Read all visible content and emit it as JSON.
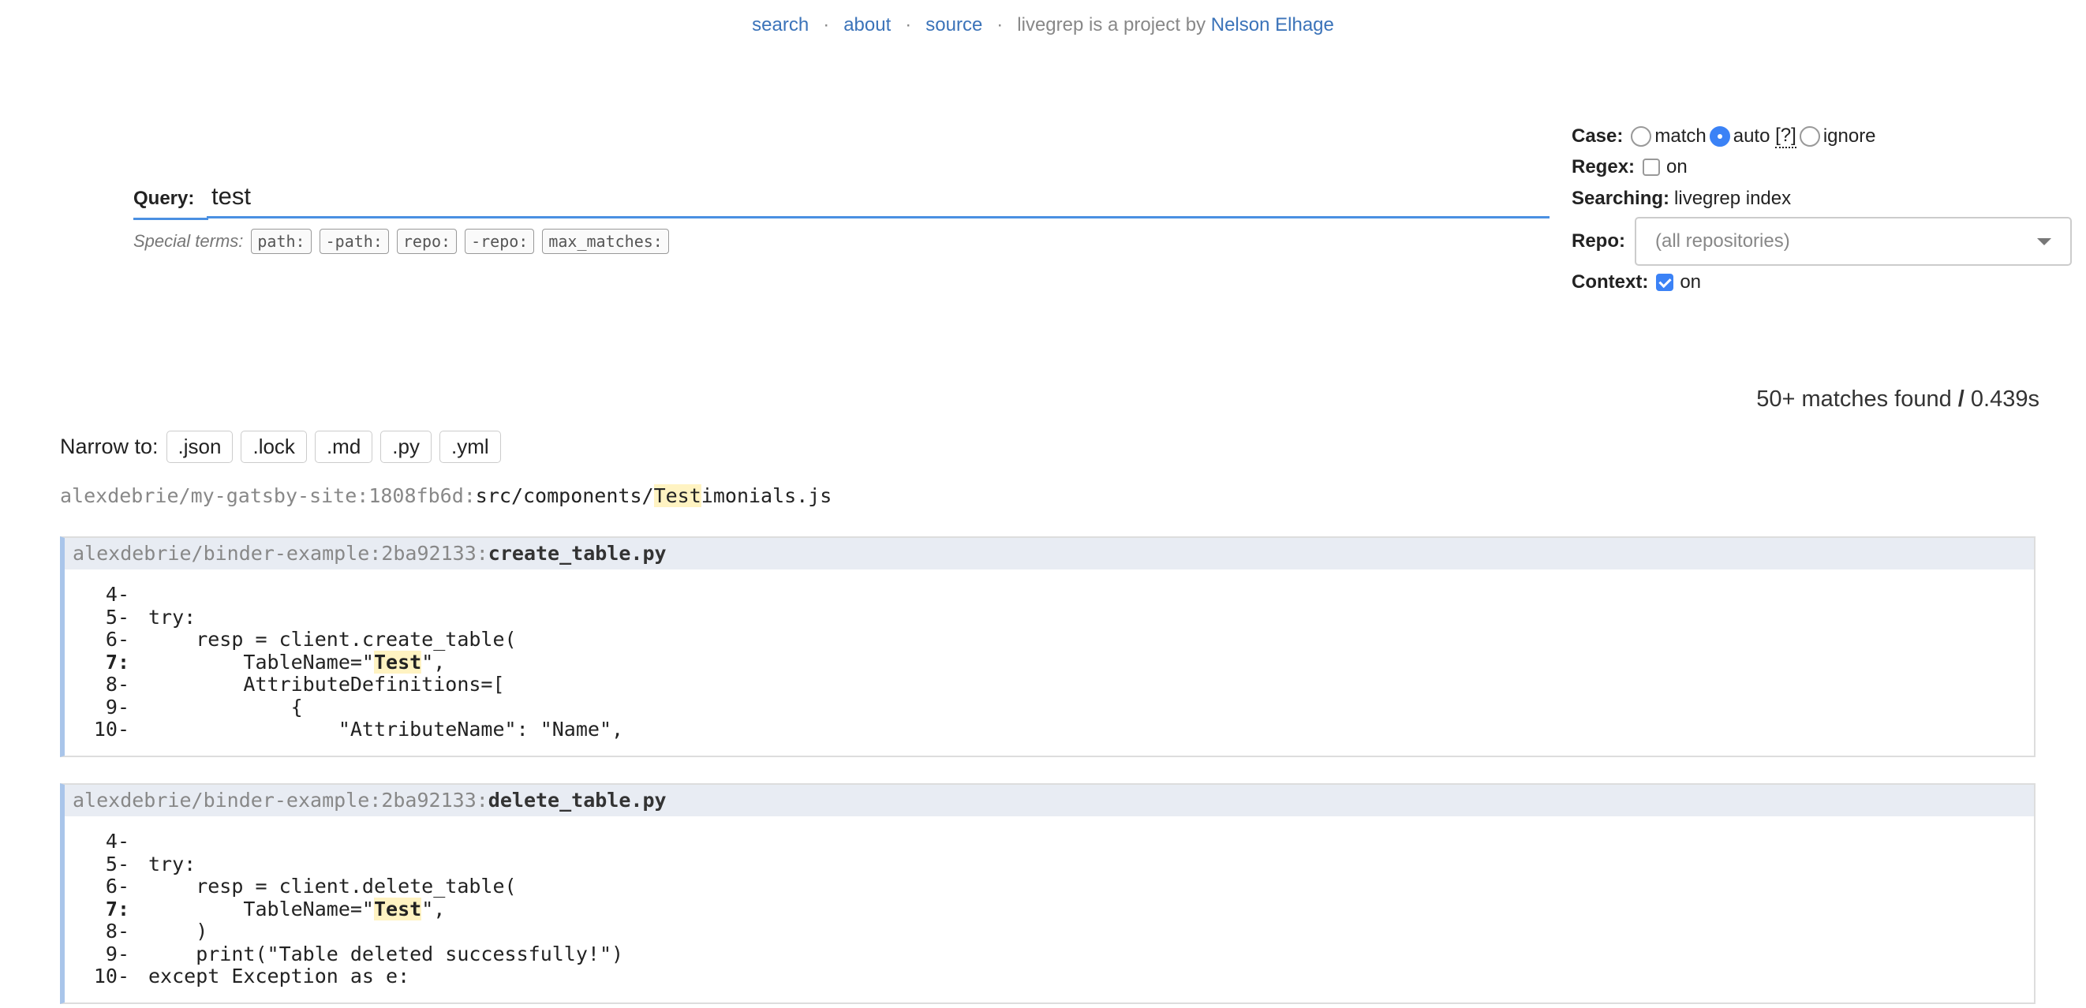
{
  "nav": {
    "search": "search",
    "about": "about",
    "source": "source",
    "sep": "·",
    "credit_prefix": "livegrep is a project by",
    "author": "Nelson Elhage"
  },
  "query": {
    "label": "Query:",
    "value": "test",
    "special_terms_label": "Special terms:",
    "special_terms": [
      "path:",
      "-path:",
      "repo:",
      "-repo:",
      "max_matches:"
    ]
  },
  "options": {
    "case_label": "Case:",
    "case_options": [
      "match",
      "auto",
      "ignore"
    ],
    "case_selected": "auto",
    "case_help": "[?]",
    "regex_label": "Regex:",
    "regex_value": "on",
    "regex_checked": false,
    "searching_label": "Searching:",
    "searching_value": "livegrep index",
    "repo_label": "Repo:",
    "repo_placeholder": "(all repositories)",
    "context_label": "Context:",
    "context_value": "on",
    "context_checked": true
  },
  "results": {
    "matches_text": "50+ matches found",
    "slash": "/",
    "time": "0.439s",
    "narrow_label": "Narrow to:",
    "narrow_options": [
      ".json",
      ".lock",
      ".md",
      ".py",
      ".yml"
    ],
    "file_match": {
      "prefix": "alexdebrie/my-gatsby-site:1808fb6d:",
      "dir": "src/components/",
      "highlight": "Test",
      "rest": "imonials.js"
    },
    "blocks": [
      {
        "repo": "alexdebrie/binder-example:2ba92133:",
        "file": "create_table.py",
        "lines": [
          {
            "no": "4-",
            "pre": "",
            "hl": "",
            "post": ""
          },
          {
            "no": "5-",
            "pre": "try:",
            "hl": "",
            "post": ""
          },
          {
            "no": "6-",
            "pre": "    resp = client.create_table(",
            "hl": "",
            "post": ""
          },
          {
            "no": "7:",
            "pre": "        TableName=\"",
            "hl": "Test",
            "post": "\","
          },
          {
            "no": "8-",
            "pre": "        AttributeDefinitions=[",
            "hl": "",
            "post": ""
          },
          {
            "no": "9-",
            "pre": "            {",
            "hl": "",
            "post": ""
          },
          {
            "no": "10-",
            "pre": "                \"AttributeName\": \"Name\",",
            "hl": "",
            "post": ""
          }
        ]
      },
      {
        "repo": "alexdebrie/binder-example:2ba92133:",
        "file": "delete_table.py",
        "lines": [
          {
            "no": "4-",
            "pre": "",
            "hl": "",
            "post": ""
          },
          {
            "no": "5-",
            "pre": "try:",
            "hl": "",
            "post": ""
          },
          {
            "no": "6-",
            "pre": "    resp = client.delete_table(",
            "hl": "",
            "post": ""
          },
          {
            "no": "7:",
            "pre": "        TableName=\"",
            "hl": "Test",
            "post": "\","
          },
          {
            "no": "8-",
            "pre": "    )",
            "hl": "",
            "post": ""
          },
          {
            "no": "9-",
            "pre": "    print(\"Table deleted successfully!\")",
            "hl": "",
            "post": ""
          },
          {
            "no": "10-",
            "pre": "except Exception as e:",
            "hl": "",
            "post": ""
          }
        ]
      }
    ]
  }
}
